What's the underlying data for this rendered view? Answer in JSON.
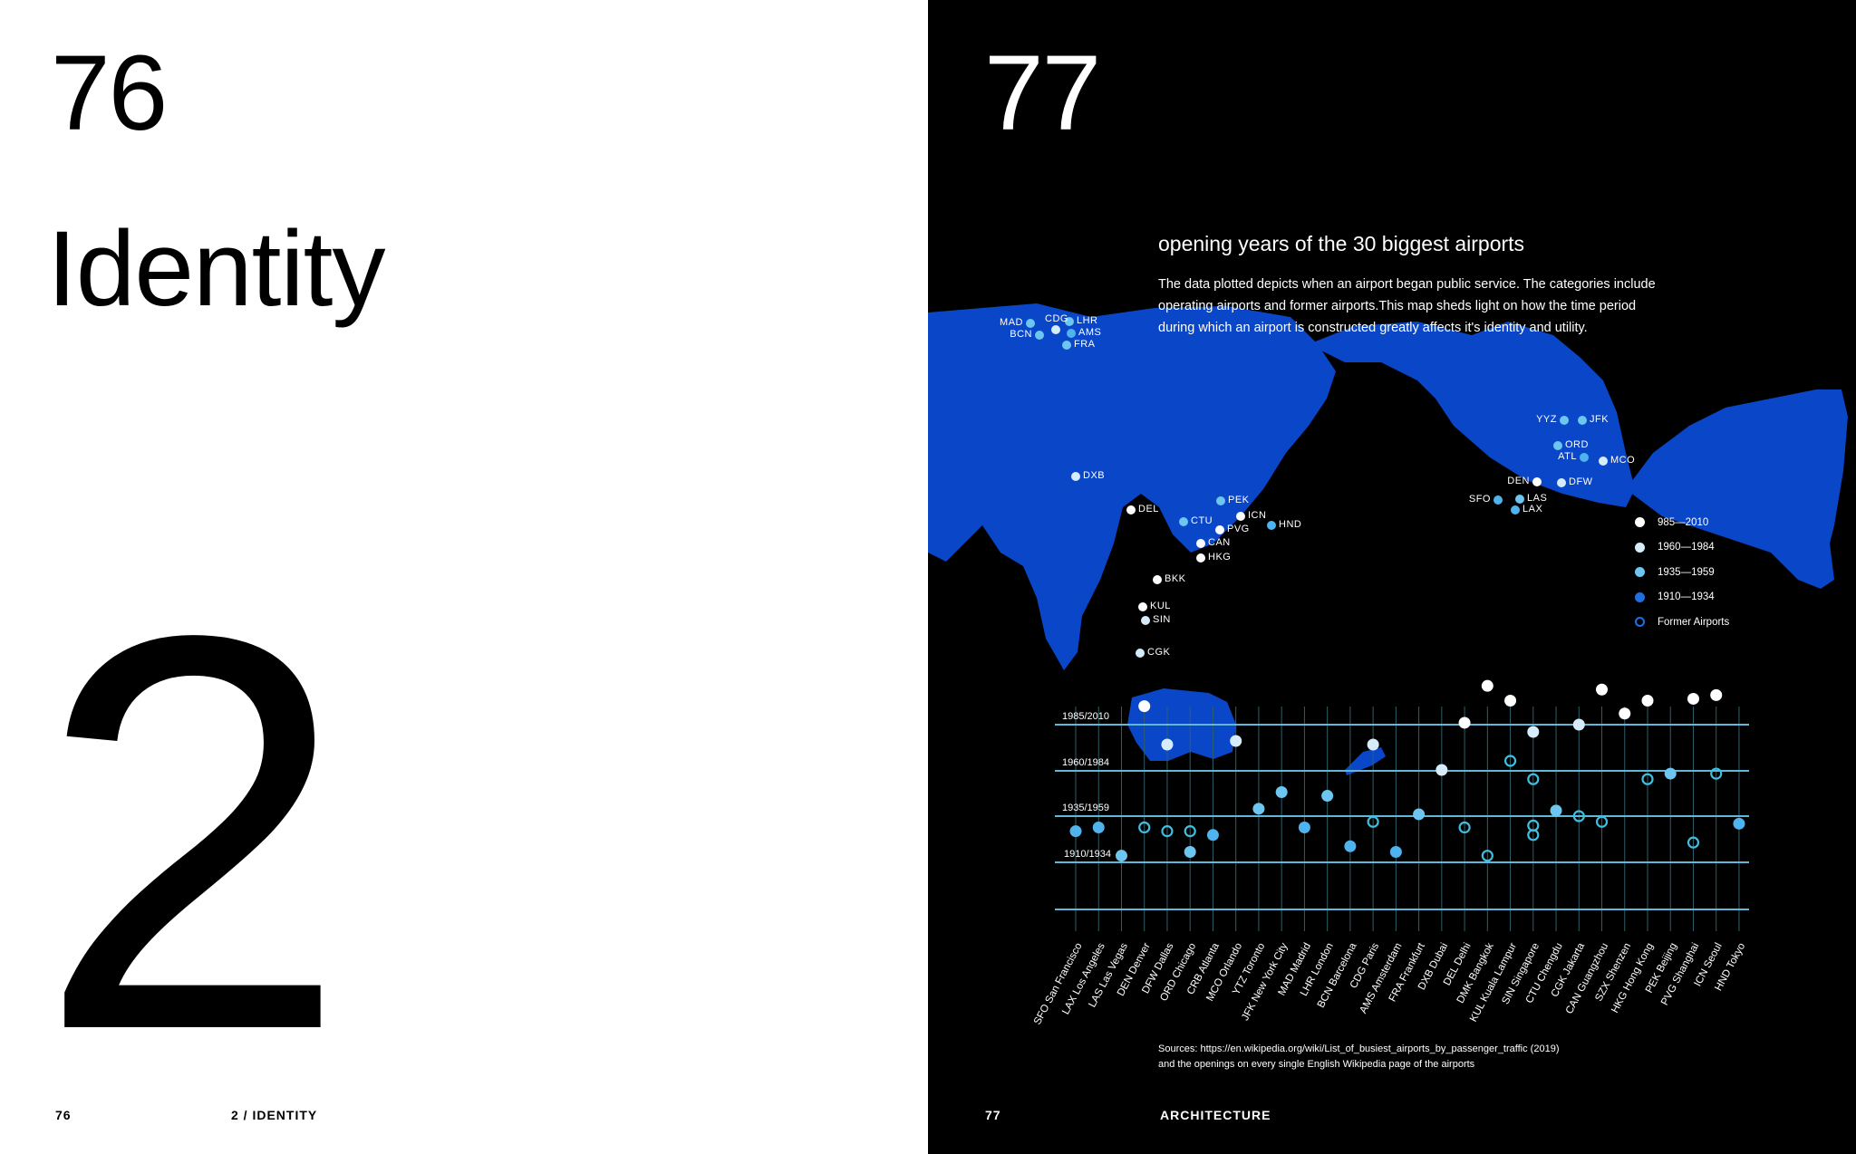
{
  "left_page": {
    "page_number_large": "76",
    "chapter_title": "Identity",
    "chapter_number": "2",
    "footer_page_number": "76",
    "footer_section": "2 / IDENTITY"
  },
  "right_page": {
    "page_number_large": "77",
    "footer_page_number": "77",
    "footer_section": "ARCHITECTURE",
    "title": "opening years of the 30 biggest airports",
    "description": "The data plotted depicts when an airport began public service. The categories include operating airports and former airports.This map sheds light on how the time period during which an airport is constructed greatly affects it's identity and utility.",
    "sources_line1": "Sources: https://en.wikipedia.org/wiki/List_of_busiest_airports_by_passenger_traffic (2019)",
    "sources_line2": "and the openings on every single English Wikipedia page of the airports"
  },
  "colors": {
    "land": "#0a46c8",
    "cat_1985_2010": "#ffffff",
    "cat_1960_1984": "#d6ecfb",
    "cat_1935_1959": "#6cc6f0",
    "cat_1910_1934": "#1f6fe0",
    "former_ring": "#3fbfe0",
    "gridline": "#5fb8d8"
  },
  "map": {
    "legend": [
      {
        "label": "985—2010",
        "category": "1985-2010"
      },
      {
        "label": "1960—1984",
        "category": "1960-1984"
      },
      {
        "label": "1935—1959",
        "category": "1935-1959"
      },
      {
        "label": "1910—1934",
        "category": "1910-1934"
      },
      {
        "label": "Former Airports",
        "category": "former"
      }
    ],
    "airports": [
      {
        "code": "MAD",
        "category": "1935-1959"
      },
      {
        "code": "CDG",
        "category": "1960-1984"
      },
      {
        "code": "LHR",
        "category": "1935-1959"
      },
      {
        "code": "AMS",
        "category": "1910-1934"
      },
      {
        "code": "BCN",
        "category": "1935-1959"
      },
      {
        "code": "FRA",
        "category": "1935-1959"
      },
      {
        "code": "DXB",
        "category": "1960-1984"
      },
      {
        "code": "DEL",
        "category": "1985-2010"
      },
      {
        "code": "PEK",
        "category": "1935-1959"
      },
      {
        "code": "ICN",
        "category": "1985-2010"
      },
      {
        "code": "CTU",
        "category": "1935-1959"
      },
      {
        "code": "HND",
        "category": "1910-1934"
      },
      {
        "code": "PVG",
        "category": "1985-2010"
      },
      {
        "code": "CAN",
        "category": "1985-2010"
      },
      {
        "code": "HKG",
        "category": "1985-2010"
      },
      {
        "code": "BKK",
        "category": "1985-2010"
      },
      {
        "code": "KUL",
        "category": "1985-2010"
      },
      {
        "code": "SIN",
        "category": "1960-1984"
      },
      {
        "code": "CGK",
        "category": "1960-1984"
      },
      {
        "code": "YYZ",
        "category": "1935-1959"
      },
      {
        "code": "JFK",
        "category": "1935-1959"
      },
      {
        "code": "ORD",
        "category": "1935-1959"
      },
      {
        "code": "ATL",
        "category": "1910-1934"
      },
      {
        "code": "MCO",
        "category": "1960-1984"
      },
      {
        "code": "DEN",
        "category": "1985-2010"
      },
      {
        "code": "DFW",
        "category": "1960-1984"
      },
      {
        "code": "SFO",
        "category": "1910-1934"
      },
      {
        "code": "LAS",
        "category": "1935-1959"
      },
      {
        "code": "LAX",
        "category": "1910-1934"
      }
    ]
  },
  "chart_data": {
    "type": "scatter",
    "title": "opening years of the 30 biggest airports",
    "xlabel": "",
    "ylabel": "",
    "y_bands": [
      "1985/2010",
      "1960/1984",
      "1935/1959",
      "1910/1934"
    ],
    "ylim": [
      1885,
      2010
    ],
    "grid": true,
    "legend_position": "right",
    "categories": [
      "SFO San Francisco",
      "LAX Los Angeles",
      "LAS Las Vegas",
      "DEN Denver",
      "DFW Dallas",
      "ORD Chicago",
      "CRB Atlanta",
      "MCO Orlando",
      "YTZ Toronto",
      "JFK New York City",
      "MAD Madrid",
      "LHR London",
      "BCN Barcelona",
      "CDG Paris",
      "AMS Amsterdam",
      "FRA Frankfurt",
      "DXB Dubai",
      "DEL Delhi",
      "DMK Bangkok",
      "KUL Kuala Lampur",
      "SIN Singapore",
      "CTU Chengdu",
      "CGK Jakarta",
      "CAN Guangzhou",
      "SZX Shenzen",
      "HKG Hong Kong",
      "PEK Beijing",
      "PVG Shanghai",
      "ICN Seoul",
      "HND Tokyo"
    ],
    "points": [
      {
        "airport": "SFO San Francisco",
        "year": 1927,
        "category": "1910-1934",
        "former": false
      },
      {
        "airport": "LAX Los Angeles",
        "year": 1929,
        "category": "1910-1934",
        "former": false
      },
      {
        "airport": "LAS Las Vegas",
        "year": 1914,
        "category": "1935-1959",
        "former": false
      },
      {
        "airport": "DEN Denver",
        "year": 1995,
        "category": "1985-2010",
        "former": false
      },
      {
        "airport": "DEN Denver",
        "year": 1929,
        "category": "1910-1934",
        "former": true
      },
      {
        "airport": "DFW Dallas",
        "year": 1974,
        "category": "1960-1984",
        "former": false
      },
      {
        "airport": "DFW Dallas",
        "year": 1927,
        "category": "1910-1934",
        "former": true
      },
      {
        "airport": "ORD Chicago",
        "year": 1916,
        "category": "1935-1959",
        "former": false
      },
      {
        "airport": "ORD Chicago",
        "year": 1927,
        "category": "1910-1934",
        "former": true
      },
      {
        "airport": "CRB Atlanta",
        "year": 1925,
        "category": "1910-1934",
        "former": false
      },
      {
        "airport": "MCO Orlando",
        "year": 1976,
        "category": "1960-1984",
        "former": false
      },
      {
        "airport": "YTZ Toronto",
        "year": 1939,
        "category": "1935-1959",
        "former": false
      },
      {
        "airport": "JFK New York City",
        "year": 1948,
        "category": "1935-1959",
        "former": false
      },
      {
        "airport": "MAD Madrid",
        "year": 1929,
        "category": "1910-1934",
        "former": false
      },
      {
        "airport": "LHR London",
        "year": 1946,
        "category": "1935-1959",
        "former": false
      },
      {
        "airport": "BCN Barcelona",
        "year": 1919,
        "category": "1910-1934",
        "former": false
      },
      {
        "airport": "CDG Paris",
        "year": 1974,
        "category": "1960-1984",
        "former": false
      },
      {
        "airport": "CDG Paris",
        "year": 1932,
        "category": "1910-1934",
        "former": true
      },
      {
        "airport": "AMS Amsterdam",
        "year": 1916,
        "category": "1910-1934",
        "former": false
      },
      {
        "airport": "FRA Frankfurt",
        "year": 1936,
        "category": "1935-1959",
        "former": false
      },
      {
        "airport": "DXB Dubai",
        "year": 1960,
        "category": "1960-1984",
        "former": false
      },
      {
        "airport": "DEL Delhi",
        "year": 1986,
        "category": "1985-2010",
        "former": false
      },
      {
        "airport": "DEL Delhi",
        "year": 1929,
        "category": "1910-1934",
        "former": true
      },
      {
        "airport": "DMK Bangkok",
        "year": 2006,
        "category": "1985-2010",
        "former": false
      },
      {
        "airport": "DMK Bangkok",
        "year": 1914,
        "category": "1910-1934",
        "former": true
      },
      {
        "airport": "KUL Kuala Lampur",
        "year": 1998,
        "category": "1985-2010",
        "former": false
      },
      {
        "airport": "KUL Kuala Lampur",
        "year": 1965,
        "category": "1960-1984",
        "former": true
      },
      {
        "airport": "SIN Singapore",
        "year": 1981,
        "category": "1960-1984",
        "former": false
      },
      {
        "airport": "SIN Singapore",
        "year": 1955,
        "category": "1935-1959",
        "former": true
      },
      {
        "airport": "SIN Singapore",
        "year": 1930,
        "category": "1910-1934",
        "former": true
      },
      {
        "airport": "SIN Singapore",
        "year": 1925,
        "category": "1910-1934",
        "former": true
      },
      {
        "airport": "CTU Chengdu",
        "year": 1938,
        "category": "1935-1959",
        "former": false
      },
      {
        "airport": "CGK Jakarta",
        "year": 1985,
        "category": "1960-1984",
        "former": false
      },
      {
        "airport": "CGK Jakarta",
        "year": 1935,
        "category": "1910-1934",
        "former": true
      },
      {
        "airport": "CAN Guangzhou",
        "year": 2004,
        "category": "1985-2010",
        "former": false
      },
      {
        "airport": "CAN Guangzhou",
        "year": 1932,
        "category": "1910-1934",
        "former": true
      },
      {
        "airport": "SZX Shenzen",
        "year": 1991,
        "category": "1985-2010",
        "former": false
      },
      {
        "airport": "HKG Hong Kong",
        "year": 1998,
        "category": "1985-2010",
        "former": false
      },
      {
        "airport": "HKG Hong Kong",
        "year": 1955,
        "category": "1935-1959",
        "former": true
      },
      {
        "airport": "PEK Beijing",
        "year": 1958,
        "category": "1935-1959",
        "former": false
      },
      {
        "airport": "PVG Shanghai",
        "year": 1999,
        "category": "1985-2010",
        "former": false
      },
      {
        "airport": "PVG Shanghai",
        "year": 1921,
        "category": "1910-1934",
        "former": true
      },
      {
        "airport": "ICN Seoul",
        "year": 2001,
        "category": "1985-2010",
        "former": false
      },
      {
        "airport": "ICN Seoul",
        "year": 1958,
        "category": "1935-1959",
        "former": true
      },
      {
        "airport": "HND Tokyo",
        "year": 1931,
        "category": "1910-1934",
        "former": false
      }
    ]
  }
}
